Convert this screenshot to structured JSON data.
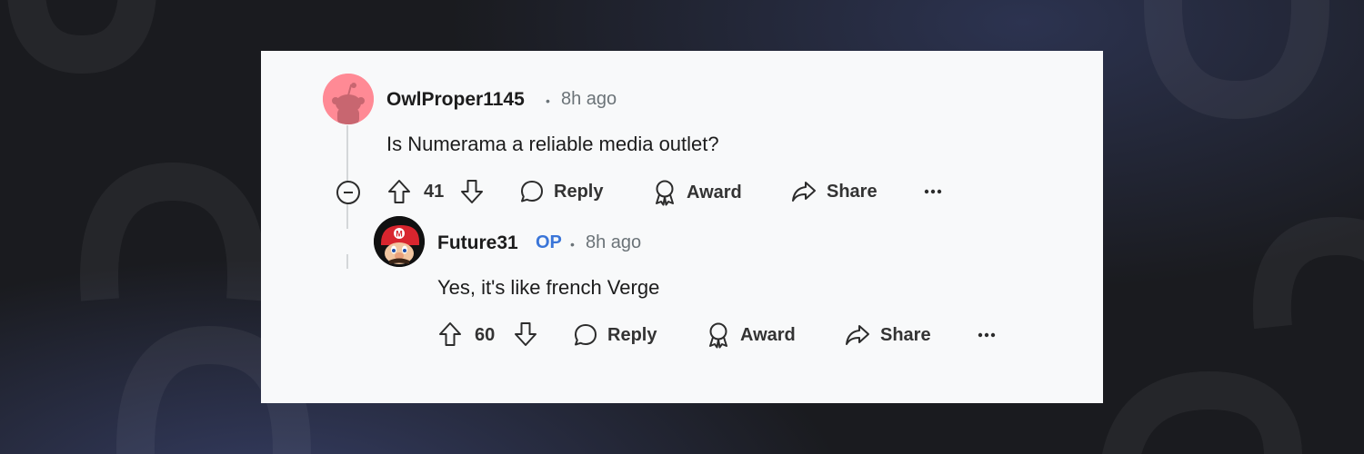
{
  "colors": {
    "background": "#1a1b1f",
    "card": "#f8f9fa",
    "text": "#1c1c1c",
    "meta": "#6b7378",
    "op_badge": "#3a75d8",
    "avatar_pink": "#ff8a95"
  },
  "comments": [
    {
      "username": "OwlProper1145",
      "separator": "•",
      "time": "8h ago",
      "text": "Is Numerama a reliable media outlet?",
      "upvotes": "41",
      "avatar_icon": "snoo-avatar-icon",
      "actions": {
        "reply": "Reply",
        "award": "Award",
        "share": "Share"
      }
    },
    {
      "username": "Future31",
      "badge": "OP",
      "separator": "•",
      "time": "8h ago",
      "text": "Yes, it's like french Verge",
      "upvotes": "60",
      "avatar_icon": "mario-avatar-icon",
      "actions": {
        "reply": "Reply",
        "award": "Award",
        "share": "Share"
      }
    }
  ],
  "icons": [
    "collapse-icon",
    "upvote-icon",
    "downvote-icon",
    "reply-icon",
    "award-icon",
    "share-icon",
    "more-options-icon"
  ]
}
